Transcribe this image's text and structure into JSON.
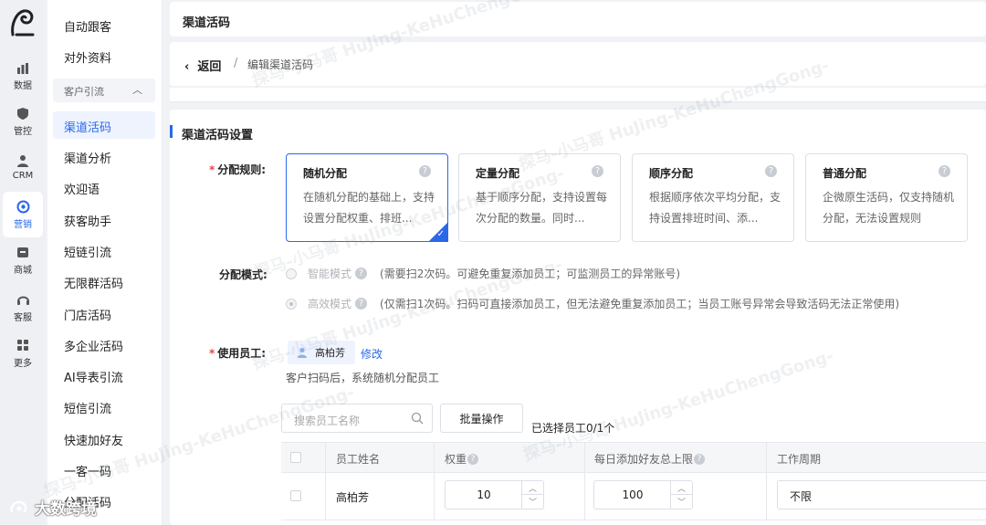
{
  "rail": {
    "items": [
      {
        "label": "数据",
        "icon": "chart-icon"
      },
      {
        "label": "管控",
        "icon": "shield-icon"
      },
      {
        "label": "CRM",
        "icon": "person-icon"
      },
      {
        "label": "营销",
        "icon": "target-icon"
      },
      {
        "label": "商城",
        "icon": "shop-icon"
      },
      {
        "label": "客服",
        "icon": "headset-icon"
      },
      {
        "label": "更多",
        "icon": "grid-icon"
      }
    ]
  },
  "menu": {
    "items_top": [
      "自动跟客",
      "对外资料"
    ],
    "group_label": "客户引流",
    "items": [
      "渠道活码",
      "渠道分析",
      "欢迎语",
      "获客助手",
      "短链引流",
      "无限群活码",
      "门店活码",
      "多企业活码",
      "AI导表引流",
      "短信引流",
      "快速加好友",
      "一客一码",
      "分配活码"
    ]
  },
  "header": {
    "title": "渠道活码"
  },
  "breadcrumb": {
    "back": "返回",
    "sep": "/",
    "current": "编辑渠道活码"
  },
  "section": {
    "title": "渠道活码设置"
  },
  "rules": {
    "label": "分配规则:",
    "cards": [
      {
        "title": "随机分配",
        "desc": "在随机分配的基础上，支持设置分配权重、排班..."
      },
      {
        "title": "定量分配",
        "desc": "基于顺序分配，支持设置每次分配的数量。同时..."
      },
      {
        "title": "顺序分配",
        "desc": "根据顺序依次平均分配，支持设置排班时间、添..."
      },
      {
        "title": "普通分配",
        "desc": "企微原生活码，仅支持随机分配，无法设置规则"
      }
    ]
  },
  "mode": {
    "label": "分配模式:",
    "options": [
      {
        "name": "智能模式",
        "desc": "(需要扫2次码。可避免重复添加员工；可监测员工的异常账号)"
      },
      {
        "name": "高效模式",
        "desc": "(仅需扫1次码。扫码可直接添加员工，但无法避免重复添加员工；当员工账号异常会导致活码无法正常使用)"
      }
    ]
  },
  "employees": {
    "label": "使用员工:",
    "tag": "高柏芳",
    "edit": "修改",
    "hint": "客户扫码后，系统随机分配员工",
    "search_placeholder": "搜索员工名称",
    "batch": "批量操作",
    "selected": "已选择员工0/1个"
  },
  "table": {
    "headers": [
      "员工姓名",
      "权重",
      "每日添加好友总上限",
      "工作周期"
    ],
    "rows": [
      {
        "name": "高柏芳",
        "weight": "10",
        "limit": "100",
        "period": "不限"
      }
    ]
  },
  "watermark": "探马-小马哥 HuJing-KeHuChengGong-",
  "footer": {
    "text": "大数跨境"
  },
  "colors": {
    "accent": "#2a68e8",
    "required": "#e5484d"
  }
}
